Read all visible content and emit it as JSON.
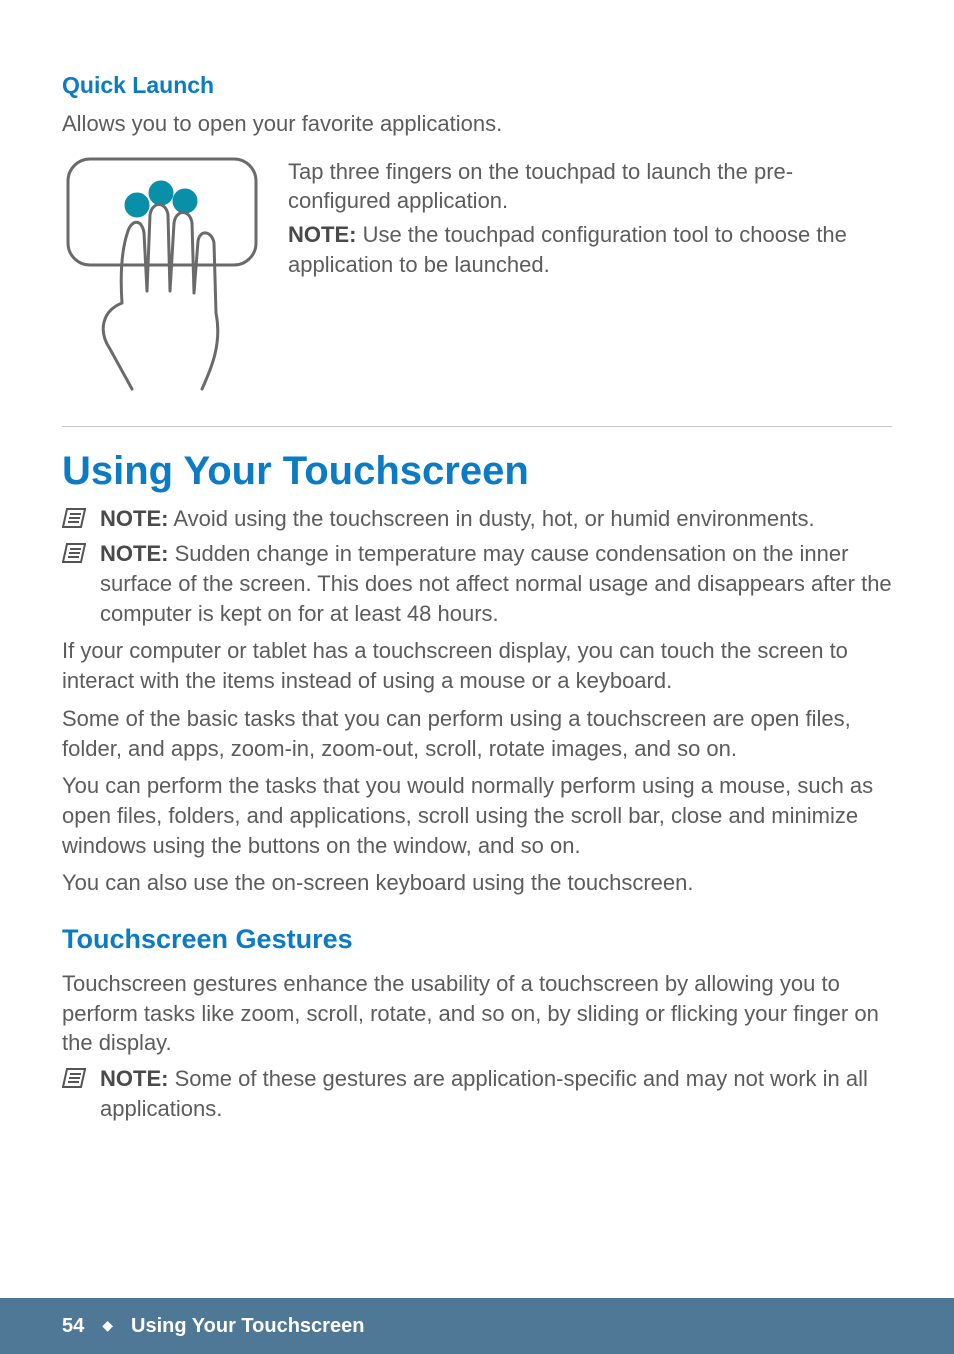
{
  "quickLaunch": {
    "heading": "Quick Launch",
    "intro": "Allows you to open your favorite applications.",
    "desc": "Tap three fingers on the touchpad to launch the pre-configured application.",
    "noteLabel": "NOTE:",
    "noteText": " Use the touchpad configuration tool to choose the application to be launched."
  },
  "section": {
    "title": "Using Your Touchscreen",
    "note1Label": "NOTE:",
    "note1Text": " Avoid using the touchscreen in dusty, hot, or humid environments.",
    "note2Label": "NOTE:",
    "note2Text": " Sudden change in temperature may cause condensation on the inner surface of the screen. This does not affect normal usage and disappears after the computer is kept on for at least 48 hours.",
    "p1": "If your computer or tablet has a touchscreen display, you can touch the screen to interact with the items instead of using a mouse or a keyboard.",
    "p2": "Some of the basic tasks that you can perform using a touchscreen are open files, folder, and apps, zoom-in, zoom-out, scroll, rotate images, and so on.",
    "p3": "You can perform the tasks that you would normally perform using a mouse, such as open files, folders, and applications, scroll using the scroll bar, close and minimize windows using the buttons on the window, and so on.",
    "p4": "You can also use the on-screen keyboard using the touchscreen."
  },
  "gestures": {
    "heading": "Touchscreen Gestures",
    "intro": "Touchscreen gestures enhance the usability of a touchscreen by allowing you to perform tasks like zoom, scroll, rotate, and so on, by sliding or flicking your finger on the display.",
    "noteLabel": "NOTE:",
    "noteText": " Some of these gestures are application-specific and may not work in all applications."
  },
  "footer": {
    "page": "54",
    "diamond": "◆",
    "title": "Using Your Touchscreen"
  }
}
